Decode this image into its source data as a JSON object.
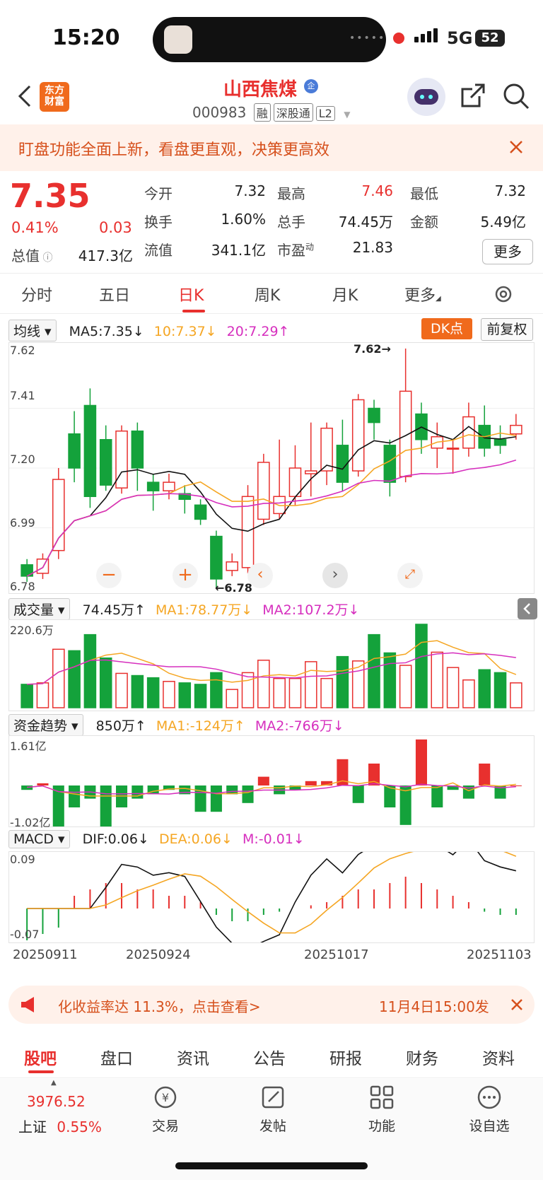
{
  "status_bar": {
    "time": "15:20",
    "network": "5G",
    "battery": "52"
  },
  "header": {
    "back_icon": "chevron-left-icon",
    "logo_line1": "东方",
    "logo_line2": "财富",
    "stock_name": "山西焦煤",
    "badge": "企",
    "code": "000983",
    "tags": [
      "融",
      "深股通",
      "L2"
    ],
    "right_icons": [
      "robot-assistant-icon",
      "share-icon",
      "search-icon"
    ]
  },
  "banner": {
    "text": "盯盘功能全面上新，看盘更直观，决策更高效"
  },
  "quote": {
    "price": "7.35",
    "change_pct": "0.41%",
    "change": "0.03",
    "total_value_label": "总值",
    "total_value": "417.3亿",
    "items": [
      {
        "label": "今开",
        "value": "7.32",
        "color": "#222222"
      },
      {
        "label": "最高",
        "value": "7.46",
        "color": "#e8302e"
      },
      {
        "label": "最低",
        "value": "7.32",
        "color": "#222222"
      },
      {
        "label": "换手",
        "value": "1.60%",
        "color": "#222222"
      },
      {
        "label": "总手",
        "value": "74.45万",
        "color": "#222222"
      },
      {
        "label": "金额",
        "value": "5.49亿",
        "color": "#222222"
      },
      {
        "label": "流值",
        "value": "341.1亿",
        "color": "#222222"
      },
      {
        "label": "市盈",
        "sup": "动",
        "value": "21.83",
        "color": "#222222"
      }
    ],
    "more_label": "更多"
  },
  "period_tabs": [
    "分时",
    "五日",
    "日K",
    "周K",
    "月K",
    "更多"
  ],
  "active_tab": "日K",
  "kline_indicators": {
    "dropdown": "均线",
    "ma5": "MA5:7.35↓",
    "ma10": "10:7.37↓",
    "ma20": "20:7.29↑",
    "dk_label": "DK点",
    "adjust_label": "前复权",
    "y_ticks": [
      "7.62",
      "7.41",
      "7.20",
      "6.99",
      "6.78"
    ],
    "high_marker": "7.62→",
    "low_marker": "←6.78"
  },
  "volume_indicators": {
    "dropdown": "成交量",
    "value": "74.45万↑",
    "ma1": "MA1:78.77万↓",
    "ma2": "MA2:107.2万↓",
    "max_label": "220.6万"
  },
  "capital_indicators": {
    "dropdown": "资金趋势",
    "value": "850万↑",
    "ma1": "MA1:-124万↑",
    "ma2": "MA2:-766万↓",
    "max_label": "1.61亿",
    "min_label": "-1.02亿"
  },
  "macd_indicators": {
    "dropdown": "MACD",
    "dif": "DIF:0.06↓",
    "dea": "DEA:0.06↓",
    "m": "M:-0.01↓",
    "max_label": "0.09",
    "min_label": "-0.07"
  },
  "dates": [
    "20250911",
    "20250924",
    "20251017",
    "20251103"
  ],
  "promo": {
    "text": "化收益率达 11.3%，点击查看>",
    "right": "11月4日15:00发"
  },
  "section_nav": [
    "股吧",
    "盘口",
    "资讯",
    "公告",
    "研报",
    "财务",
    "资料"
  ],
  "bottom_bar": {
    "index_value": "3976.52",
    "index_name": "上证",
    "index_change": "0.55%",
    "items": [
      {
        "label": "交易",
        "icon": "yuan-exchange-icon"
      },
      {
        "label": "发帖",
        "icon": "edit-post-icon"
      },
      {
        "label": "功能",
        "icon": "grid-apps-icon"
      },
      {
        "label": "设自选",
        "icon": "more-dots-icon"
      }
    ]
  },
  "chart_data": {
    "type": "candlestick",
    "y_range": [
      6.78,
      7.62
    ],
    "candles": [
      {
        "o": 6.86,
        "c": 6.82,
        "h": 6.88,
        "l": 6.8
      },
      {
        "o": 6.83,
        "c": 6.88,
        "h": 6.9,
        "l": 6.81
      },
      {
        "o": 6.91,
        "c": 7.16,
        "h": 7.2,
        "l": 6.88
      },
      {
        "o": 7.32,
        "c": 7.2,
        "h": 7.4,
        "l": 7.15
      },
      {
        "o": 7.42,
        "c": 7.1,
        "h": 7.48,
        "l": 7.06
      },
      {
        "o": 7.3,
        "c": 7.14,
        "h": 7.35,
        "l": 7.12
      },
      {
        "o": 7.13,
        "c": 7.33,
        "h": 7.35,
        "l": 7.11
      },
      {
        "o": 7.33,
        "c": 7.2,
        "h": 7.36,
        "l": 7.12
      },
      {
        "o": 7.15,
        "c": 7.12,
        "h": 7.18,
        "l": 7.05
      },
      {
        "o": 7.12,
        "c": 7.15,
        "h": 7.18,
        "l": 7.09
      },
      {
        "o": 7.11,
        "c": 7.09,
        "h": 7.14,
        "l": 7.04
      },
      {
        "o": 7.07,
        "c": 7.02,
        "h": 7.09,
        "l": 7.0
      },
      {
        "o": 6.96,
        "c": 6.81,
        "h": 6.98,
        "l": 6.78
      },
      {
        "o": 6.84,
        "c": 6.87,
        "h": 6.9,
        "l": 6.82
      },
      {
        "o": 6.85,
        "c": 7.1,
        "h": 7.14,
        "l": 6.83
      },
      {
        "o": 7.02,
        "c": 7.22,
        "h": 7.25,
        "l": 7.0
      },
      {
        "o": 7.04,
        "c": 7.1,
        "h": 7.3,
        "l": 7.02
      },
      {
        "o": 7.1,
        "c": 7.2,
        "h": 7.28,
        "l": 7.07
      },
      {
        "o": 7.18,
        "c": 7.19,
        "h": 7.36,
        "l": 7.1
      },
      {
        "o": 7.19,
        "c": 7.34,
        "h": 7.36,
        "l": 7.14
      },
      {
        "o": 7.28,
        "c": 7.15,
        "h": 7.37,
        "l": 7.12
      },
      {
        "o": 7.19,
        "c": 7.44,
        "h": 7.46,
        "l": 7.17
      },
      {
        "o": 7.41,
        "c": 7.36,
        "h": 7.44,
        "l": 7.3
      },
      {
        "o": 7.28,
        "c": 7.15,
        "h": 7.3,
        "l": 7.1
      },
      {
        "o": 7.17,
        "c": 7.47,
        "h": 7.62,
        "l": 7.15
      },
      {
        "o": 7.39,
        "c": 7.3,
        "h": 7.43,
        "l": 7.25
      },
      {
        "o": 7.27,
        "c": 7.31,
        "h": 7.36,
        "l": 7.2
      },
      {
        "o": 7.27,
        "c": 7.27,
        "h": 7.3,
        "l": 7.18
      },
      {
        "o": 7.27,
        "c": 7.38,
        "h": 7.43,
        "l": 7.24
      },
      {
        "o": 7.35,
        "c": 7.27,
        "h": 7.42,
        "l": 7.24
      },
      {
        "o": 7.3,
        "c": 7.28,
        "h": 7.35,
        "l": 7.25
      },
      {
        "o": 7.32,
        "c": 7.35,
        "h": 7.39,
        "l": 7.3
      }
    ],
    "volume": [
      32,
      34,
      80,
      78,
      100,
      68,
      47,
      44,
      41,
      36,
      34,
      32,
      48,
      25,
      48,
      65,
      40,
      40,
      63,
      40,
      70,
      64,
      100,
      75,
      58,
      150,
      76,
      55,
      38,
      52,
      48,
      34
    ],
    "capital": [
      -0.1,
      0.05,
      -1.0,
      -0.5,
      -0.3,
      -1.0,
      -0.5,
      -0.3,
      -0.2,
      -0.1,
      -0.2,
      -0.6,
      -0.6,
      -0.2,
      -0.4,
      0.2,
      -0.2,
      -0.1,
      0.1,
      0.1,
      0.6,
      -0.4,
      0.5,
      -0.5,
      -0.9,
      1.05,
      -0.5,
      -0.1,
      -0.3,
      0.5,
      -0.3,
      0.0
    ],
    "macd_m": [
      -0.05,
      -0.04,
      -0.03,
      0.02,
      0.03,
      0.04,
      0.04,
      0.03,
      0.03,
      0.02,
      0.02,
      0.01,
      -0.01,
      -0.02,
      -0.02,
      -0.01,
      -0.005,
      0.0,
      0.005,
      0.01,
      0.02,
      0.03,
      0.03,
      0.04,
      0.05,
      0.04,
      0.03,
      0.02,
      0.01,
      -0.005,
      -0.01,
      -0.01
    ]
  }
}
